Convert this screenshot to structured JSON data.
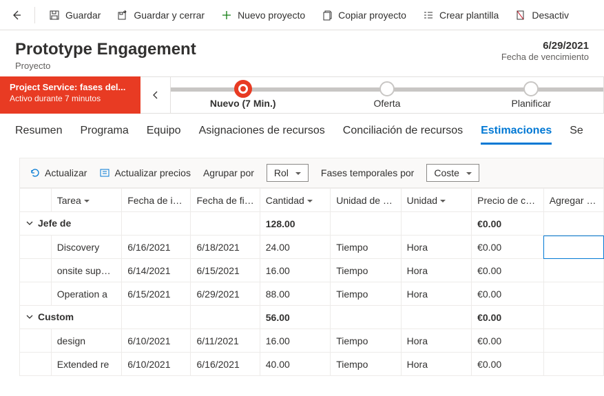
{
  "cmd": {
    "save": "Guardar",
    "save_close": "Guardar y cerrar",
    "new": "Nuevo proyecto",
    "copy": "Copiar proyecto",
    "template": "Crear plantilla",
    "deactivate": "Desactiv"
  },
  "header": {
    "title": "Prototype Engagement",
    "subtitle": "Proyecto",
    "due_date": "6/29/2021",
    "due_label": "Fecha de vencimiento"
  },
  "process": {
    "title": "Project Service: fases del...",
    "subtitle": "Activo durante 7 minutos",
    "stages": {
      "new": "Nuevo  (7 Min.)",
      "offer": "Oferta",
      "plan": "Planificar"
    }
  },
  "tabs": {
    "summary": "Resumen",
    "schedule": "Programa",
    "team": "Equipo",
    "assign": "Asignaciones de recursos",
    "reconcile": "Conciliación de recursos",
    "estimates": "Estimaciones",
    "se": "Se"
  },
  "toolbar": {
    "refresh": "Actualizar",
    "update_prices": "Actualizar precios",
    "group_by_label": "Agrupar por",
    "group_by_value": "Rol",
    "phase_label": "Fases temporales por",
    "phase_value": "Coste"
  },
  "columns": {
    "task": "Tarea",
    "start": "Fecha de inicio",
    "end": "Fecha de finali",
    "quantity": "Cantidad",
    "sales_unit": "Unidad de ven",
    "unit": "Unidad",
    "cost_price": "Precio de coste",
    "add": "Agregar col"
  },
  "groups": [
    {
      "name": "Jefe de",
      "quantity": "128.00",
      "price": "€0.00",
      "rows": [
        {
          "task": "Discovery",
          "start": "6/16/2021",
          "end": "6/18/2021",
          "qty": "24.00",
          "su": "Tiempo",
          "unit": "Hora",
          "price": "€0.00",
          "selected_add": true
        },
        {
          "task": "onsite support",
          "start": "6/14/2021",
          "end": "6/15/2021",
          "qty": "16.00",
          "su": "Tiempo",
          "unit": "Hora",
          "price": "€0.00"
        },
        {
          "task": "Operation a",
          "start": "6/15/2021",
          "end": "6/29/2021",
          "qty": "88.00",
          "su": "Tiempo",
          "unit": "Hora",
          "price": "€0.00"
        }
      ]
    },
    {
      "name": "Custom",
      "quantity": "56.00",
      "price": "€0.00",
      "rows": [
        {
          "task": "design",
          "start": "6/10/2021",
          "end": "6/11/2021",
          "qty": "16.00",
          "su": "Tiempo",
          "unit": "Hora",
          "price": "€0.00"
        },
        {
          "task": "Extended re",
          "start": "6/10/2021",
          "end": "6/16/2021",
          "qty": "40.00",
          "su": "Tiempo",
          "unit": "Hora",
          "price": "€0.00"
        }
      ]
    }
  ]
}
